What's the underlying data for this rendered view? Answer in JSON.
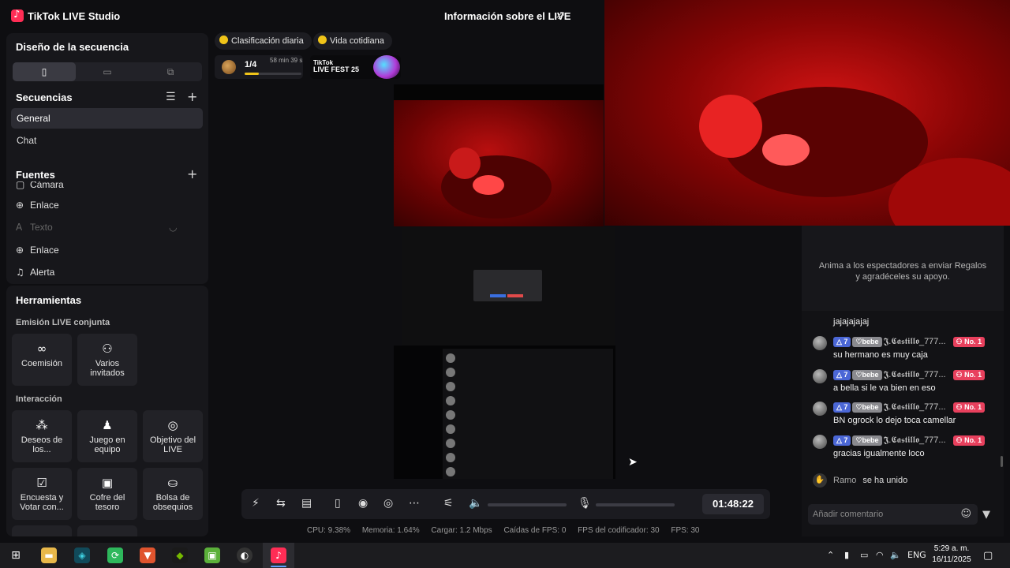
{
  "app": {
    "title": "TikTok LIVE Studio",
    "live_info": "Información sobre el LIVE"
  },
  "scene_layout": {
    "title": "Diseño de la secuencia"
  },
  "scenes": {
    "title": "Secuencias",
    "items": [
      "General",
      "Chat"
    ]
  },
  "sources": {
    "title": "Fuentes",
    "items": [
      {
        "label": "Cámara",
        "icon": "camera-icon"
      },
      {
        "label": "Enlace",
        "icon": "globe-icon"
      },
      {
        "label": "Texto",
        "icon": "text-icon"
      },
      {
        "label": "Enlace",
        "icon": "globe-icon"
      },
      {
        "label": "Alerta",
        "icon": "bell-icon"
      }
    ]
  },
  "tools": {
    "title": "Herramientas",
    "multi_guest_heading": "Emisión LIVE conjunta",
    "multi_guest": [
      {
        "label": "Coemisión",
        "icon": "link-icon"
      },
      {
        "label": "Varios invitados",
        "icon": "people-icon"
      }
    ],
    "interaction_heading": "Interacción",
    "interaction": [
      {
        "label": "Deseos de los...",
        "icon": "gift-wish-icon"
      },
      {
        "label": "Juego en equipo",
        "icon": "joystick-icon"
      },
      {
        "label": "Objetivo del LIVE",
        "icon": "target-icon"
      },
      {
        "label": "Encuesta y Votar con...",
        "icon": "poll-icon"
      },
      {
        "label": "Cofre del tesoro",
        "icon": "chest-icon"
      },
      {
        "label": "Bolsa de obsequios",
        "icon": "bag-icon"
      }
    ]
  },
  "pills": {
    "ranking": "Clasificación diaria",
    "daily": "Vida cotidiana"
  },
  "rank_card": {
    "position": "1/4",
    "time_left": "58 min 39 s",
    "progress": 0.25
  },
  "fest": {
    "brand": "TikTok",
    "name": "LIVE FEST 25"
  },
  "gift_hint": "Anima a los espectadores a enviar Regalos y agradéceles su apoyo.",
  "chat": {
    "top_partial": "jajajajajaj",
    "messages": [
      {
        "level": "7",
        "fan_badge": "bebe",
        "user": "𝕵.𝕮𝖆𝖘𝖙𝖎𝖑𝖑𝖔_777...",
        "rank": "No. 1",
        "text": "su hermano es muy caja"
      },
      {
        "level": "7",
        "fan_badge": "bebe",
        "user": "𝕵.𝕮𝖆𝖘𝖙𝖎𝖑𝖑𝖔_777...",
        "rank": "No. 1",
        "text": "a bella si le va bien en eso"
      },
      {
        "level": "7",
        "fan_badge": "bebe",
        "user": "𝕵.𝕮𝖆𝖘𝖙𝖎𝖑𝖑𝖔_777...",
        "rank": "No. 1",
        "text": "BN ogrock lo dejo toca camellar"
      },
      {
        "level": "7",
        "fan_badge": "bebe",
        "user": "𝕵.𝕮𝖆𝖘𝖙𝖎𝖑𝖑𝖔_777...",
        "rank": "No. 1",
        "text": "gracias igualmente loco"
      }
    ],
    "join": {
      "user": "Ramo",
      "text": "se ha unido"
    },
    "comment_placeholder": "Añadir comentario"
  },
  "controls": {
    "timer": "01:48:22"
  },
  "stats": {
    "cpu": "CPU: 9.38%",
    "memory": "Memoria: 1.64%",
    "upload": "Cargar: 1.2 Mbps",
    "fps_drops": "Caídas de FPS: 0",
    "encoder_fps": "FPS del codificador: 30",
    "fps": "FPS: 30"
  },
  "taskbar": {
    "lang": "ENG",
    "time": "5:29 a. m.",
    "date": "16/11/2025"
  }
}
